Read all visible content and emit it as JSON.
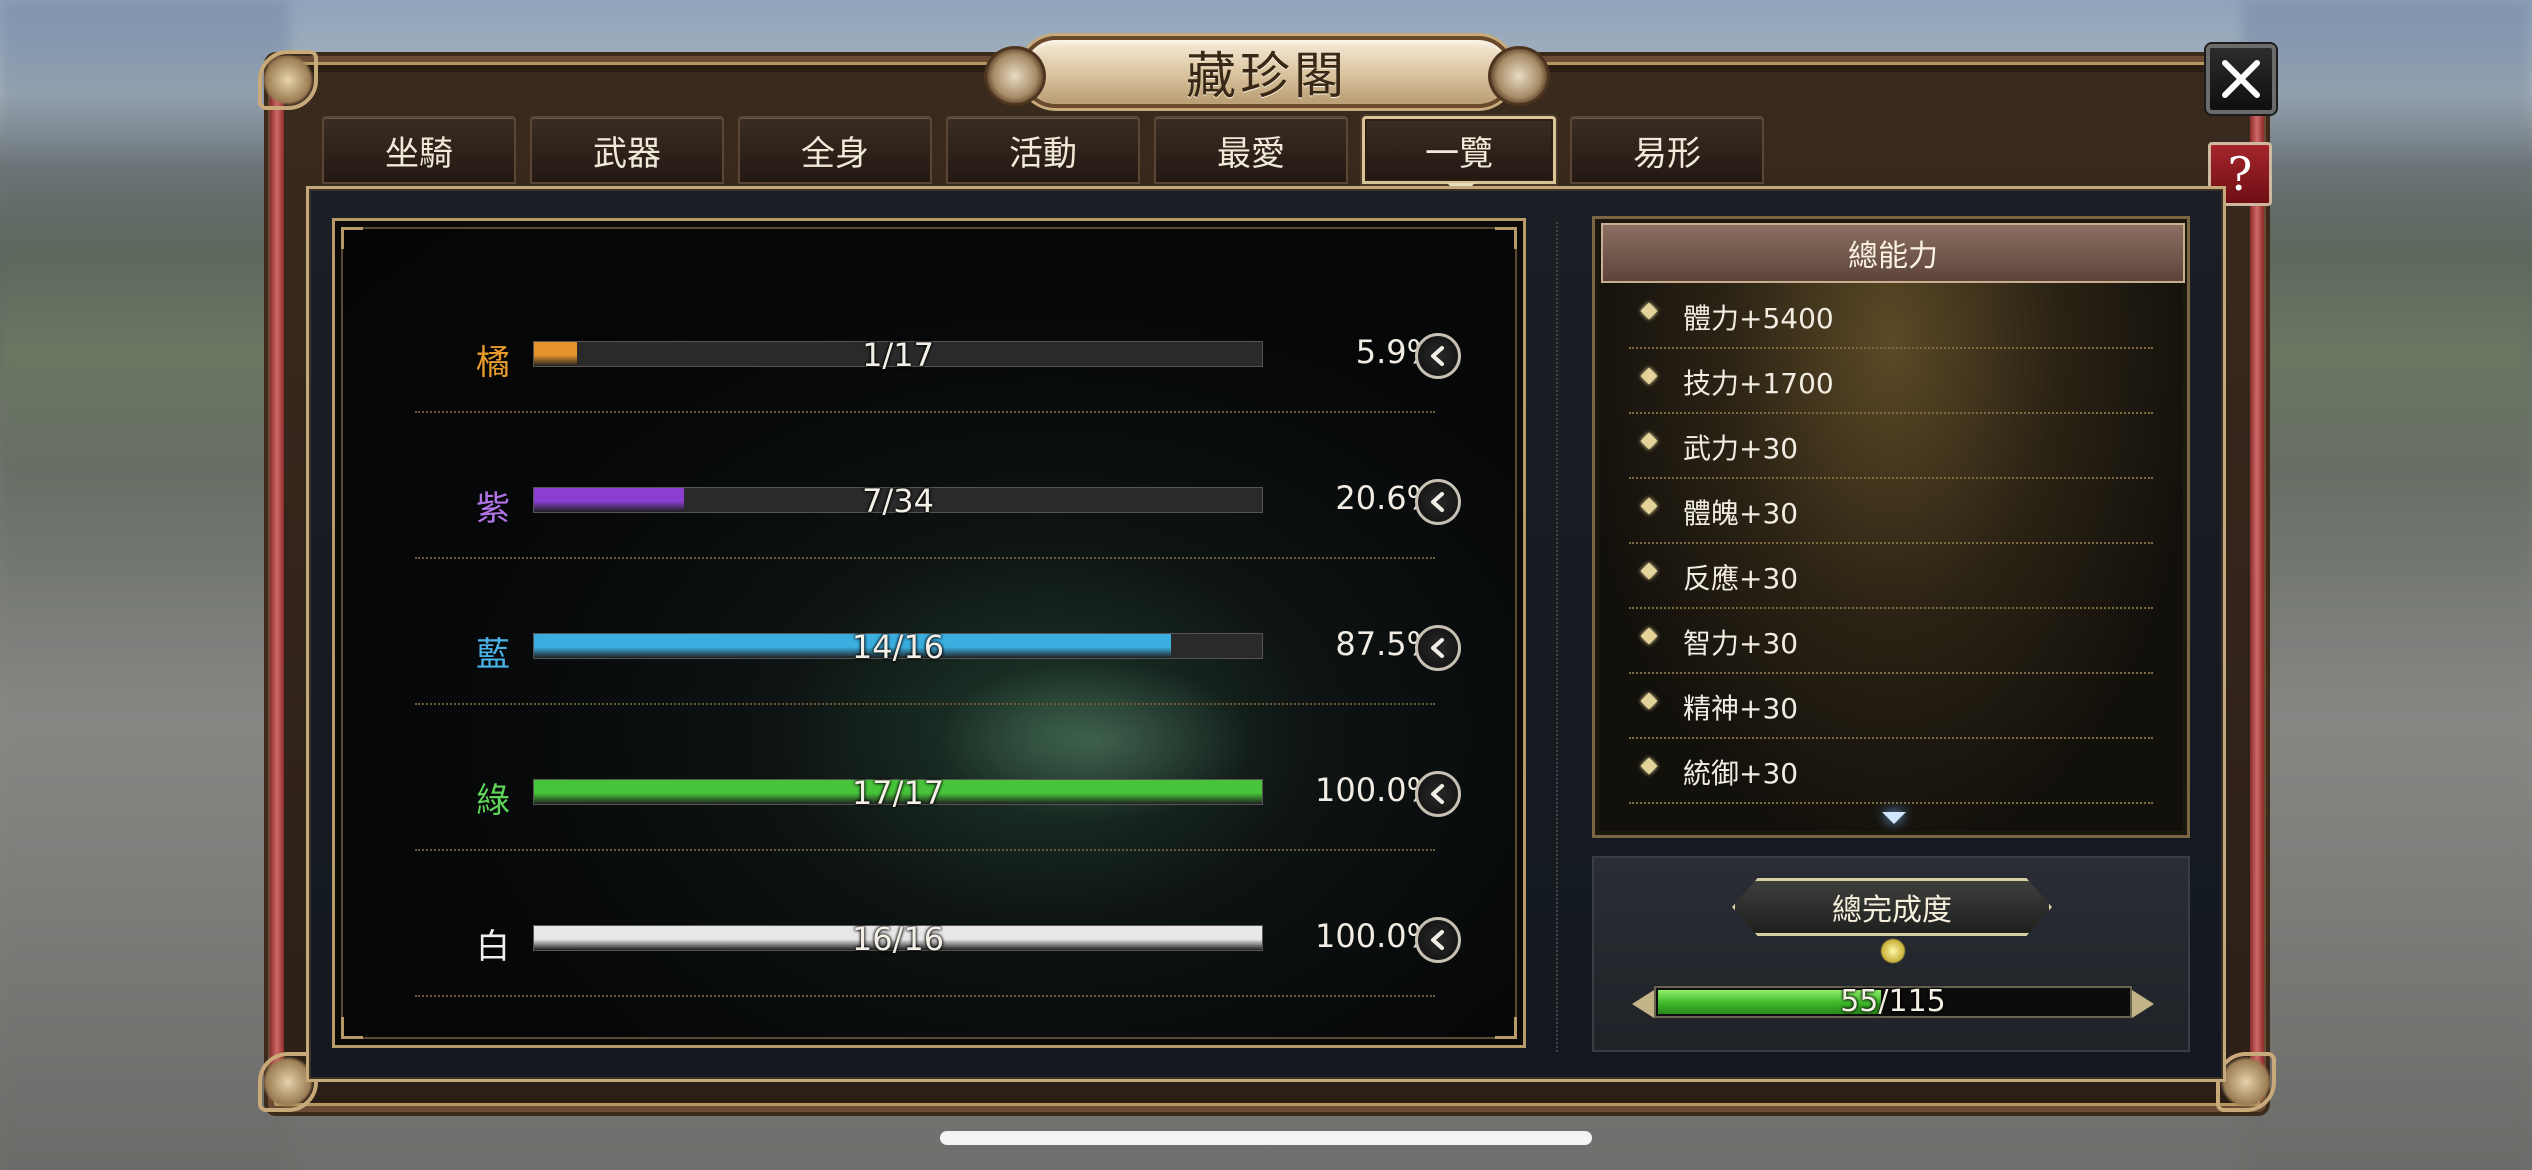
{
  "title": "藏珍閣",
  "tabs": [
    {
      "label": "坐騎",
      "active": false
    },
    {
      "label": "武器",
      "active": false
    },
    {
      "label": "全身",
      "active": false
    },
    {
      "label": "活動",
      "active": false
    },
    {
      "label": "最愛",
      "active": false
    },
    {
      "label": "一覽",
      "active": true
    },
    {
      "label": "易形",
      "active": false
    }
  ],
  "help_label": "?",
  "rarity_rows": [
    {
      "label": "橘",
      "count_text": "1/17",
      "percent": "5.9%",
      "fraction": 0.059,
      "color": "#e89a2c",
      "fill": "#e3932a"
    },
    {
      "label": "紫",
      "count_text": "7/34",
      "percent": "20.6%",
      "fraction": 0.206,
      "color": "#b074e6",
      "fill": "#8b3fd1"
    },
    {
      "label": "藍",
      "count_text": "14/16",
      "percent": "87.5%",
      "fraction": 0.875,
      "color": "#49b3e6",
      "fill": "#3aaedf"
    },
    {
      "label": "綠",
      "count_text": "17/17",
      "percent": "100.0%",
      "fraction": 1.0,
      "color": "#5fd35a",
      "fill": "#47c43a"
    },
    {
      "label": "白",
      "count_text": "16/16",
      "percent": "100.0%",
      "fraction": 1.0,
      "color": "#f0f0f0",
      "fill": "#e8e8e8"
    }
  ],
  "stats_panel": {
    "header": "總能力",
    "items": [
      "體力+5400",
      "技力+1700",
      "武力+30",
      "體魄+30",
      "反應+30",
      "智力+30",
      "精神+30",
      "統御+30"
    ]
  },
  "completion": {
    "label": "總完成度",
    "value_text": "55/115",
    "fraction": 0.478
  }
}
